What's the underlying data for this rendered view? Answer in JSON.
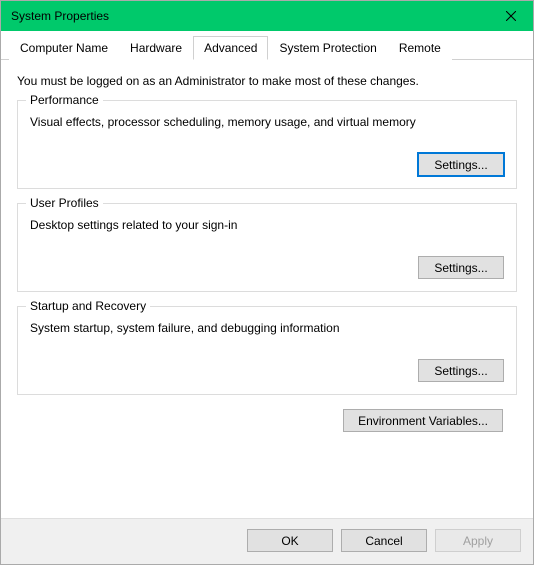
{
  "window": {
    "title": "System Properties"
  },
  "tabs": {
    "computer_name": "Computer Name",
    "hardware": "Hardware",
    "advanced": "Advanced",
    "system_protection": "System Protection",
    "remote": "Remote"
  },
  "intro": "You must be logged on as an Administrator to make most of these changes.",
  "groups": {
    "performance": {
      "title": "Performance",
      "desc": "Visual effects, processor scheduling, memory usage, and virtual memory",
      "button": "Settings..."
    },
    "user_profiles": {
      "title": "User Profiles",
      "desc": "Desktop settings related to your sign-in",
      "button": "Settings..."
    },
    "startup_recovery": {
      "title": "Startup and Recovery",
      "desc": "System startup, system failure, and debugging information",
      "button": "Settings..."
    }
  },
  "env_button": "Environment Variables...",
  "footer": {
    "ok": "OK",
    "cancel": "Cancel",
    "apply": "Apply"
  }
}
